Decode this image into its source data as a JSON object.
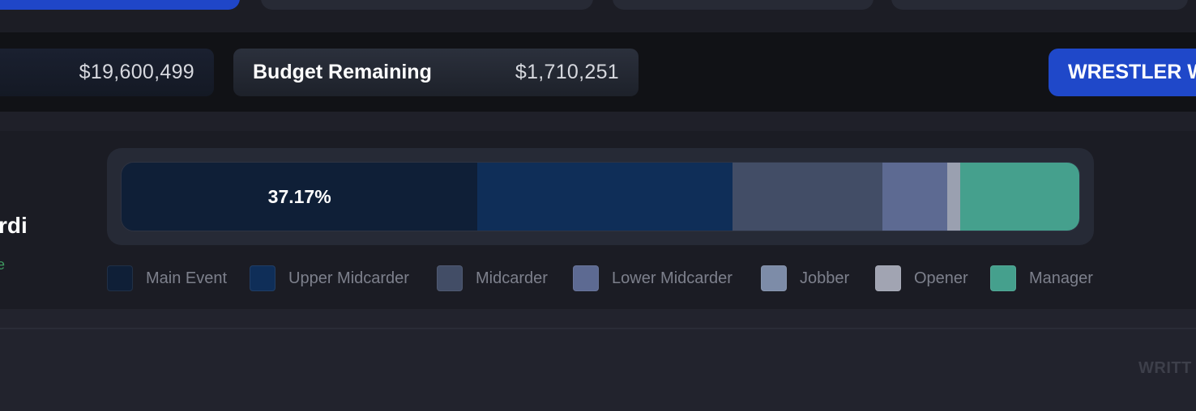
{
  "budget": {
    "spent_value": "$19,600,499",
    "remaining_label": "Budget Remaining",
    "remaining_value": "$1,710,251",
    "wrestler_button": "WRESTLER W"
  },
  "profile": {
    "name_fragment": "rdi",
    "sub_fragment": "e"
  },
  "roster_chart": {
    "highlight_label": "37.17%",
    "segments": [
      {
        "name": "Main Event",
        "fraction": 0.3717,
        "color": "#0f1f37"
      },
      {
        "name": "Upper Midcarder",
        "fraction": 0.266,
        "color": "#0f2e58"
      },
      {
        "name": "Midcarder",
        "fraction": 0.1564,
        "color": "#424d66"
      },
      {
        "name": "Lower Midcarder",
        "fraction": 0.0676,
        "color": "#5d6a92"
      },
      {
        "name": "Jobber",
        "fraction": 0.0,
        "color": "#7d8ca8"
      },
      {
        "name": "Opener",
        "fraction": 0.0135,
        "color": "#9aa0b0"
      },
      {
        "name": "Manager",
        "fraction": 0.1248,
        "color": "#45a08d"
      }
    ]
  },
  "legend": [
    {
      "label": "Main Event",
      "color": "#0f1f37"
    },
    {
      "label": "Upper Midcarder",
      "color": "#0f2e58"
    },
    {
      "label": "Midcarder",
      "color": "#424d66"
    },
    {
      "label": "Lower Midcarder",
      "color": "#5d6a92"
    },
    {
      "label": "Jobber",
      "color": "#7d8ca8"
    },
    {
      "label": "Opener",
      "color": "#a1a4b2"
    },
    {
      "label": "Manager",
      "color": "#45a08d"
    }
  ],
  "footer": {
    "written_fragment": "WRITT"
  }
}
